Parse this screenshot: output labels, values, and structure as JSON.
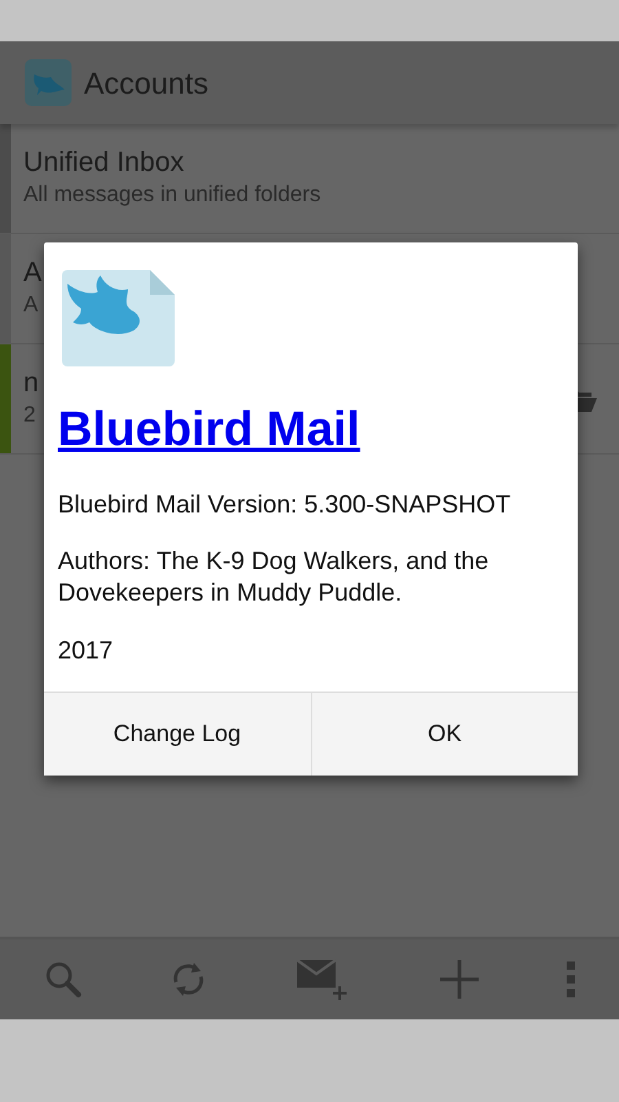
{
  "app_bar": {
    "title": "Accounts"
  },
  "accounts": [
    {
      "name": "Unified Inbox",
      "description": "All messages in unified folders",
      "color": "#4c4c4c",
      "folder_icon": false
    },
    {
      "name": "A",
      "description": "A",
      "color": "#585858",
      "folder_icon": false
    },
    {
      "name": "n",
      "description": "2",
      "color": "#3b5410",
      "folder_icon": true
    }
  ],
  "dialog": {
    "title": "Bluebird Mail",
    "paragraphs": [
      "Bluebird Mail Version: 5.300-SNAPSHOT",
      "Authors: The K-9 Dog Walkers, and the Dovekeepers in Muddy Puddle.",
      "2017"
    ],
    "buttons": [
      "Change Log",
      "OK"
    ]
  }
}
